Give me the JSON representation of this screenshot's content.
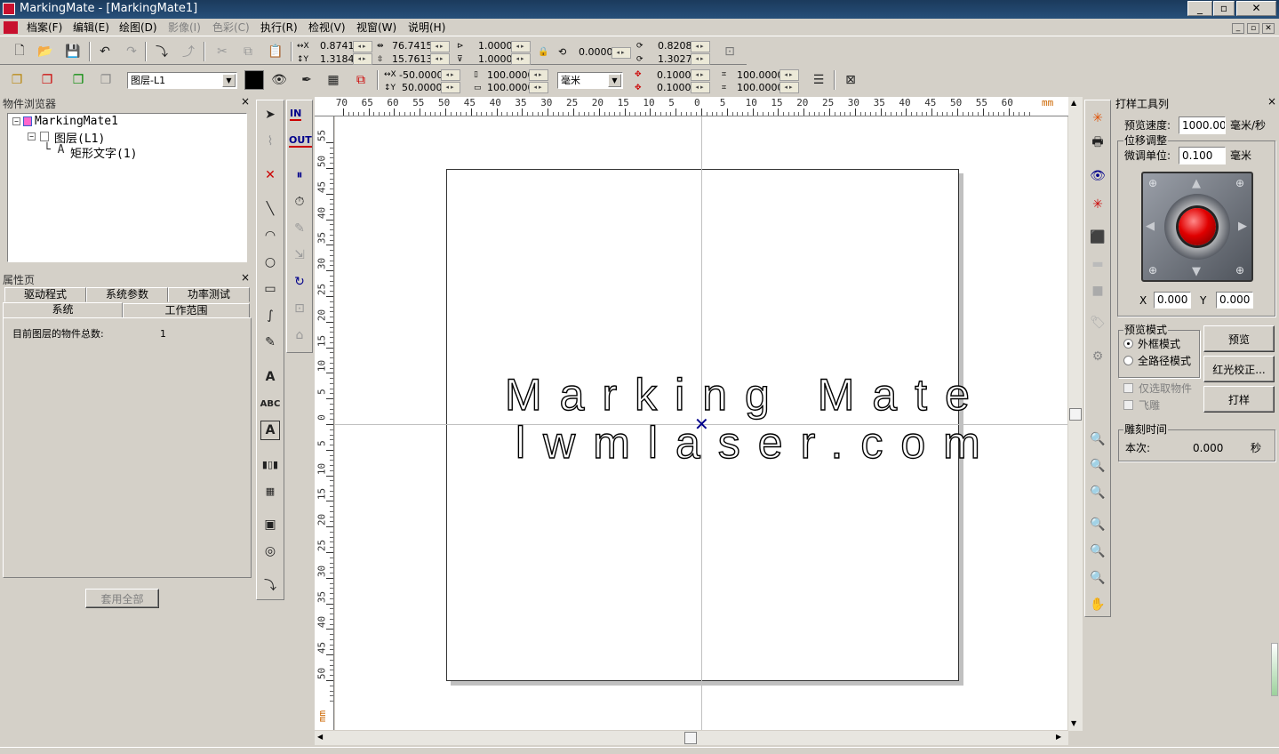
{
  "window": {
    "title": "MarkingMate - [MarkingMate1]"
  },
  "menu": [
    "档案(F)",
    "编辑(E)",
    "绘图(D)",
    "影像(I)",
    "色彩(C)",
    "执行(R)",
    "检视(V)",
    "视窗(W)",
    "说明(H)"
  ],
  "toolbar1": {
    "x": "0.8741",
    "y": "1.3184",
    "w": "76.7415",
    "h": "15.7613",
    "sx": "1.0000",
    "sy": "1.0000",
    "rot": "0.0000",
    "rx": "0.8208",
    "ry": "1.3027"
  },
  "toolbar2": {
    "layer": "图层-L1",
    "px": "-50.0000",
    "py": "50.0000",
    "sw": "100.0000",
    "sh": "100.0000",
    "unit": "毫米",
    "gx": "0.1000",
    "gy": "0.1000",
    "ax": "100.0000",
    "ay": "100.0000"
  },
  "browser": {
    "title": "物件浏览器",
    "tree": [
      "MarkingMate1",
      "图层(L1)",
      "矩形文字(1)"
    ]
  },
  "props": {
    "title": "属性页",
    "tabs_row1": [
      "驱动程式",
      "系统参数",
      "功率测试"
    ],
    "tabs_row2": [
      "系统",
      "工作范围"
    ],
    "count_label": "目前图层的物件总数:",
    "count_value": "1",
    "apply_button": "套用全部"
  },
  "left_tools": {
    "in": "IN",
    "out": "OUT"
  },
  "ruler": {
    "h_labels": [
      "70",
      "65",
      "60",
      "55",
      "50",
      "45",
      "40",
      "35",
      "30",
      "25",
      "20",
      "15",
      "10",
      "5",
      "0",
      "5",
      "10",
      "15",
      "20",
      "25",
      "30",
      "35",
      "40",
      "45",
      "50",
      "55",
      "60"
    ],
    "v_labels": [
      "55",
      "50",
      "45",
      "40",
      "35",
      "30",
      "25",
      "20",
      "15",
      "10",
      "5",
      "0",
      "5",
      "10",
      "15",
      "20",
      "25",
      "30",
      "35",
      "40",
      "45",
      "50"
    ],
    "unit": "mm"
  },
  "canvas": {
    "line1": "Marking Mate",
    "line2": "lwmlaser.com"
  },
  "sample_panel": {
    "title": "打样工具列",
    "speed_label": "预览速度:",
    "speed_value": "1000.000",
    "speed_unit": "毫米/秒",
    "offset_group": "位移调整",
    "step_label": "微调单位:",
    "step_value": "0.100",
    "step_unit": "毫米",
    "x_label": "X",
    "x_value": "0.000",
    "y_label": "Y",
    "y_value": "0.000",
    "mode_group": "预览模式",
    "mode_frame": "外框模式",
    "mode_full": "全路径模式",
    "preview_button": "预览",
    "redlight_button": "红光校正...",
    "print_button": "打样",
    "only_selected": "仅选取物件",
    "fly": "飞雕",
    "time_group": "雕刻时间",
    "this_time_label": "本次:",
    "this_time_value": "0.000",
    "time_unit": "秒"
  }
}
